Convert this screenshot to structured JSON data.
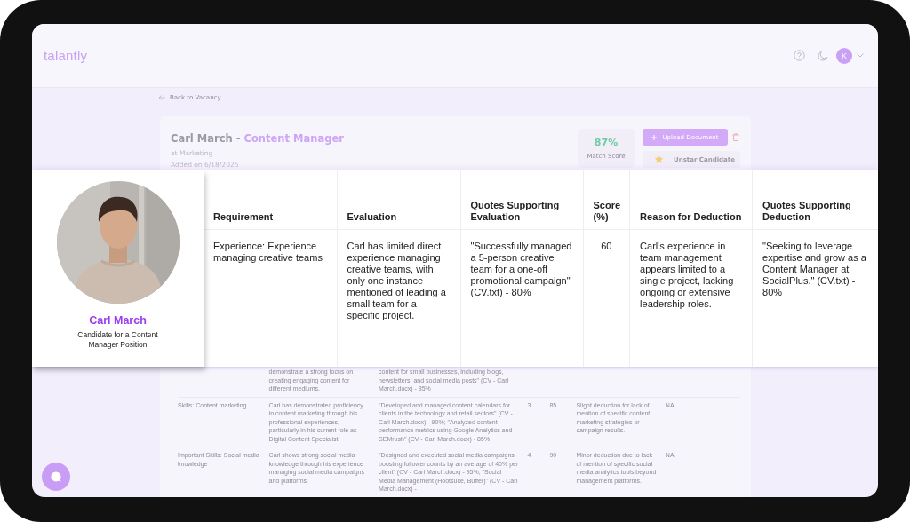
{
  "header": {
    "logo": "talantly",
    "avatar_initial": "K"
  },
  "back_link": "Back to Vacancy",
  "candidate": {
    "title_prefix": "Carl March -",
    "position": "Content Manager",
    "department": "at Marketing",
    "added": "Added on 6/18/2025",
    "match_score": "87%",
    "match_label": "Match Score",
    "upload_button": "Upload Document",
    "star_button": "Unstar Candidate",
    "starred": true
  },
  "requirements_table": {
    "rows": [
      {
        "evaluation": "demonstrate a strong focus on creating engaging content for different mediums.",
        "quotes": "content for small businesses, including blogs, newsletters, and social media posts\" (CV - Carl March.docx) - 85%"
      },
      {
        "requirement": "Skills: Content marketing",
        "evaluation": "Carl has demonstrated proficiency in content marketing through his professional experiences, particularly in his current role as Digital Content Specialist.",
        "quotes": "\"Developed and managed content calendars for clients in the technology and retail sectors\" (CV - Carl March.docx) - 90%; \"Analyzed content performance metrics using Google Analytics and SEMrush\" (CV - Carl March.docx) - 85%",
        "column_4": "3",
        "score": "85",
        "reason": "Slight deduction for lack of mention of specific content marketing strategies or campaign results.",
        "deduction_quotes": "NA"
      },
      {
        "requirement": "Important Skills: Social media knowledge",
        "evaluation": "Carl shows strong social media knowledge through his experience managing social media campaigns and platforms.",
        "quotes": "\"Designed and executed social media campaigns, boosting follower counts by an average of 40% per client\" (CV - Carl March.docx) - 95%; \"Social Media Management (Hootsuite, Buffer)\" (CV - Carl March.docx) -",
        "column_4": "4",
        "score": "90",
        "reason": "Minor deduction due to lack of mention of specific social media analytics tools beyond management platforms.",
        "deduction_quotes": "NA"
      }
    ]
  },
  "evaluation_card": {
    "profile": {
      "name": "Carl March",
      "subtitle": "Candidate for a Content Manager Position"
    },
    "columns": [
      "Requirement",
      "Evaluation",
      "Quotes Supporting Evaluation",
      "Score (%)",
      "Reason for Deduction",
      "Quotes Supporting Deduction"
    ],
    "rows": [
      {
        "cells": [
          "Experience: Experience managing creative teams",
          "Carl has limited direct experience managing creative teams, with only one instance mentioned of leading a small team for a specific project.",
          "\"Successfully managed a 5-person creative team for a one-off promotional campaign\" (CV.txt) - 80%",
          "60",
          "Carl's experience in team management appears limited to a single project, lacking ongoing or extensive leadership roles.",
          "\"Seeking to leverage expertise and grow as a Content Manager at SocialPlus.\" (CV.txt) - 80%"
        ]
      }
    ]
  }
}
